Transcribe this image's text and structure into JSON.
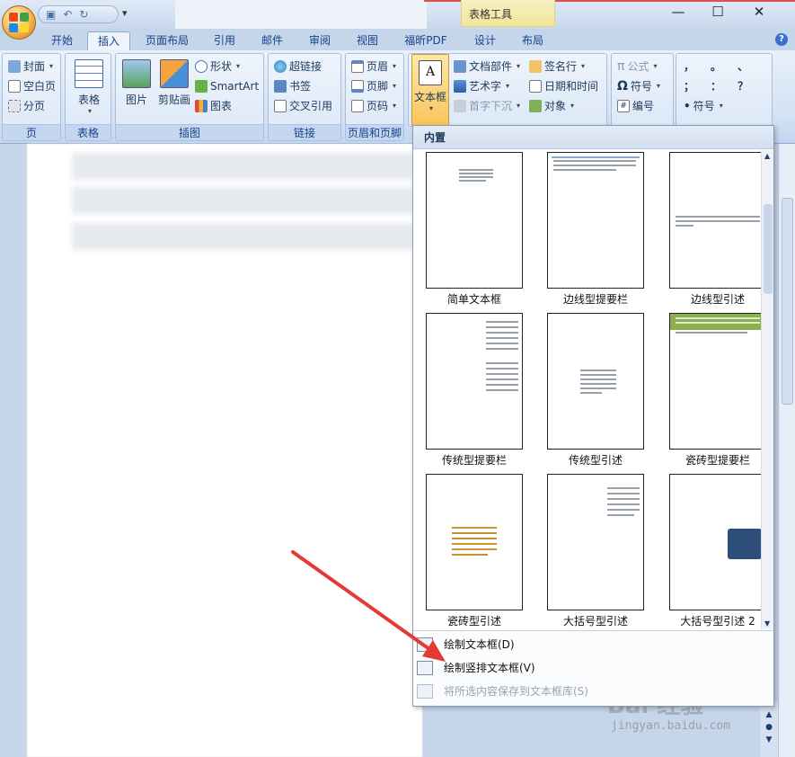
{
  "colors": {
    "accent": "#15428b",
    "highlight": "#f9c55b",
    "arrow": "#e53935"
  },
  "titlebar": {
    "tools_tab": "表格工具",
    "qat_icons": [
      "save-icon",
      "undo-icon",
      "redo-icon"
    ],
    "window_controls": [
      "minimize-icon",
      "maximize-icon",
      "close-icon"
    ]
  },
  "tabs": [
    "开始",
    "插入",
    "页面布局",
    "引用",
    "邮件",
    "审阅",
    "视图",
    "福昕PDF",
    "设计",
    "布局"
  ],
  "active_tab": "插入",
  "ribbon": {
    "page_group": {
      "label": "页",
      "items": [
        "封面",
        "空白页",
        "分页"
      ]
    },
    "table_group": {
      "label": "表格",
      "button": "表格"
    },
    "illustration_group": {
      "label": "插图",
      "picture": "图片",
      "clipart": "剪贴画",
      "shapes": "形状",
      "smartart": "SmartArt",
      "chart": "图表"
    },
    "links_group": {
      "label": "链接",
      "items": [
        "超链接",
        "书签",
        "交叉引用"
      ]
    },
    "header_footer_group": {
      "label": "页眉和页脚",
      "items": [
        "页眉",
        "页脚",
        "页码"
      ]
    },
    "text_group": {
      "textbox": "文本框",
      "items_col1": [
        "文档部件",
        "艺术字",
        "首字下沉"
      ],
      "items_col2": [
        "签名行",
        "日期和时间",
        "对象"
      ]
    },
    "symbol_group": {
      "formula": "公式",
      "symbol": "符号",
      "number": "编号",
      "symbol2": "符号",
      "punct": [
        "，",
        "。",
        "、",
        "；",
        "：",
        "？"
      ]
    }
  },
  "gallery": {
    "header": "内置",
    "thumbnails": [
      "简单文本框",
      "边线型提要栏",
      "边线型引述",
      "传统型提要栏",
      "传统型引述",
      "瓷砖型提要栏",
      "瓷砖型引述",
      "大括号型引述",
      "大括号型引述 2"
    ],
    "menu": [
      "绘制文本框(D)",
      "绘制竖排文本框(V)",
      "将所选内容保存到文本框库(S)"
    ]
  },
  "watermark": {
    "main": "Bai 经验",
    "sub": "jingyan.baidu.com"
  }
}
